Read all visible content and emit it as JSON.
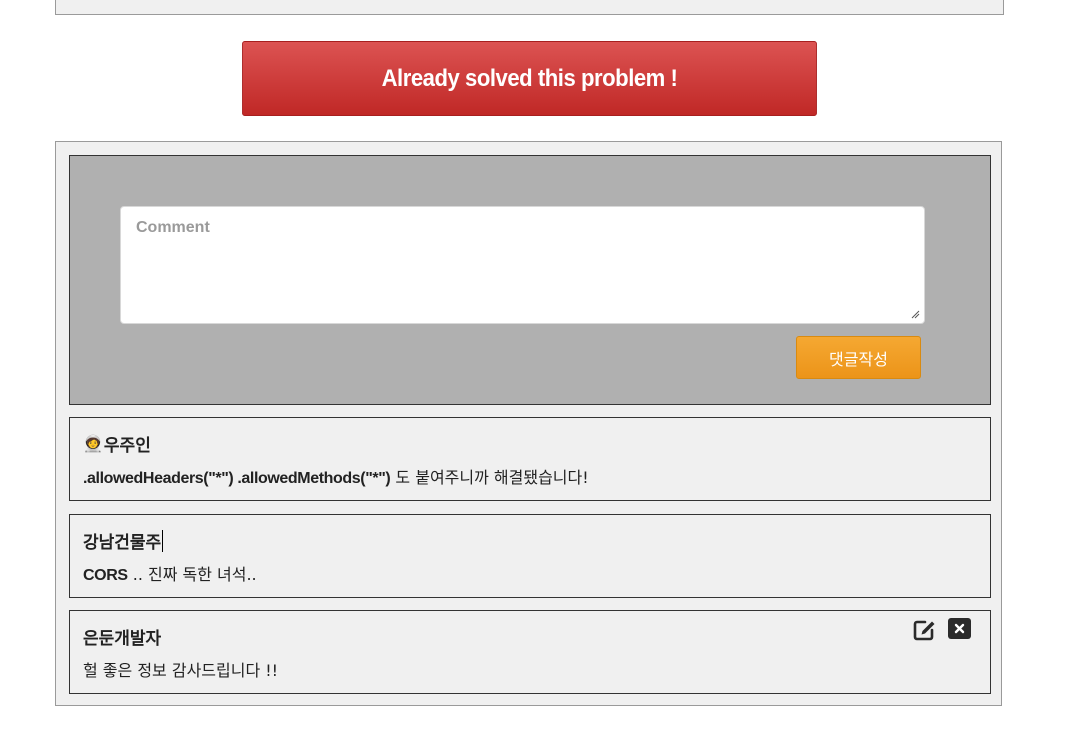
{
  "solved_button": {
    "label": "Already solved this problem !"
  },
  "comment_form": {
    "placeholder": "Comment",
    "submit_label": "댓글작성"
  },
  "comments": [
    {
      "author": "우주인",
      "author_icon": "🧑‍🚀",
      "code_part": ".allowedHeaders(\"*\") .allowedMethods(\"*\")",
      "text_part": " 도 붙여주니까 해결됐습니다!"
    },
    {
      "author": "강남건물주",
      "code_part": "CORS",
      "text_part": " .. 진짜 독한 녀석.."
    },
    {
      "author": "은둔개발자",
      "text_part": "헐 좋은 정보 감사드립니다 !!",
      "actions": [
        "edit-icon",
        "delete-icon"
      ]
    }
  ],
  "colors": {
    "solved_button": "#c9302c",
    "submit_button": "#f0a020",
    "write_box_bg": "#b0b0b0",
    "panel_bg": "#f0f0f0"
  }
}
